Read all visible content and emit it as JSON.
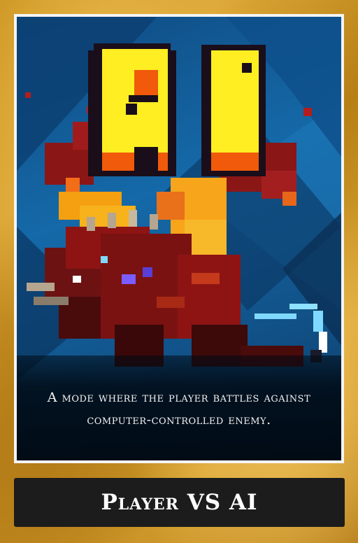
{
  "card": {
    "art_logo_text": "AI",
    "description": "A mode where the player battles against computer-controlled enemy.",
    "title": "Player VS AI"
  },
  "colors": {
    "frame_gold": "#d9a433",
    "background_blue": "#1569a8",
    "logo_yellow": "#ffee22",
    "logo_orange": "#f05a0a",
    "dragon_red": "#8e1414",
    "title_bar": "#1c1c1c"
  }
}
